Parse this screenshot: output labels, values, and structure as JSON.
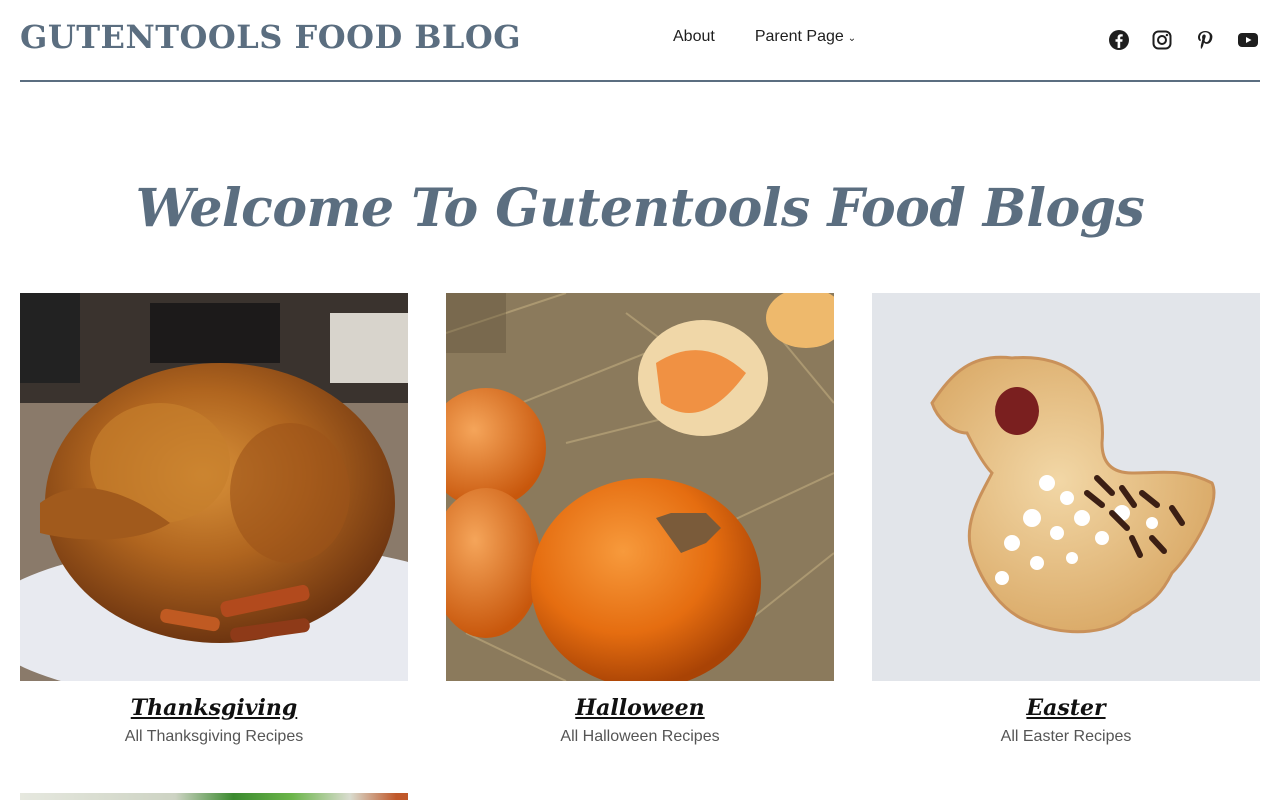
{
  "site": {
    "title": "GUTENTOOLS FOOD BLOG"
  },
  "nav": {
    "items": [
      {
        "label": "About"
      },
      {
        "label": "Parent Page",
        "has_submenu": true
      }
    ]
  },
  "social": [
    {
      "icon": "facebook-icon"
    },
    {
      "icon": "instagram-icon"
    },
    {
      "icon": "pinterest-icon"
    },
    {
      "icon": "youtube-icon"
    }
  ],
  "hero": {
    "title": "Welcome To Gutentools Food Blogs"
  },
  "cards": [
    {
      "title": "Thanksgiving",
      "subtitle": "All Thanksgiving Recipes",
      "image": "roast-turkey-photo"
    },
    {
      "title": "Halloween",
      "subtitle": "All Halloween Recipes",
      "image": "pumpkins-photo"
    },
    {
      "title": "Easter",
      "subtitle": "All Easter Recipes",
      "image": "duck-cookie-photo"
    }
  ],
  "colors": {
    "accent": "#5b6e80",
    "text": "#1e1e1e",
    "muted": "#555555"
  }
}
